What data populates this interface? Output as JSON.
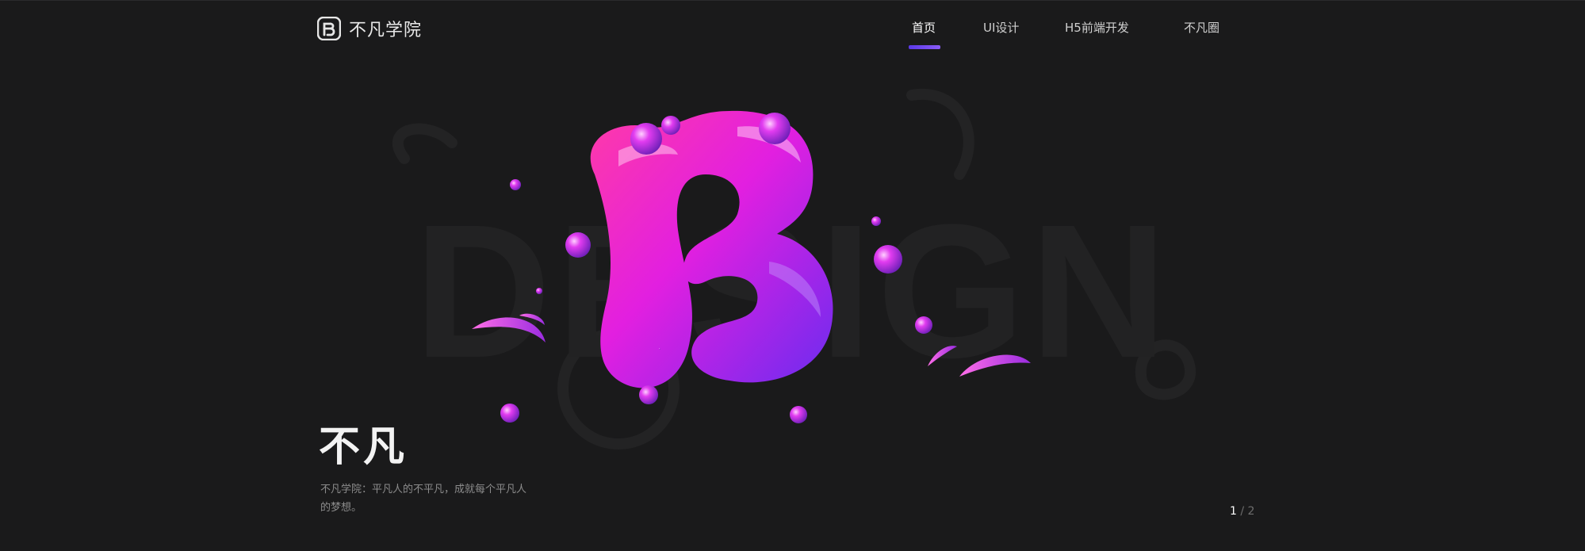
{
  "brand": {
    "name": "不凡学院",
    "logo_icon": "fb-logo-icon"
  },
  "nav": {
    "items": [
      {
        "label": "首页",
        "active": true
      },
      {
        "label": "UI设计",
        "active": false
      },
      {
        "label": "H5前端开发",
        "active": false
      },
      {
        "label": "不凡圈",
        "active": false
      }
    ]
  },
  "hero": {
    "background_word": "DESIGN",
    "title": "不凡",
    "description": "不凡学院：平凡人的不平凡，成就每个平凡人的梦想。"
  },
  "pager": {
    "current": "1",
    "separator": "/",
    "total": "2"
  },
  "colors": {
    "background": "#1a1a1b",
    "accent": "#6a45f0",
    "blob_pink": "#ff2fb0",
    "blob_purple": "#7a2bf0"
  }
}
